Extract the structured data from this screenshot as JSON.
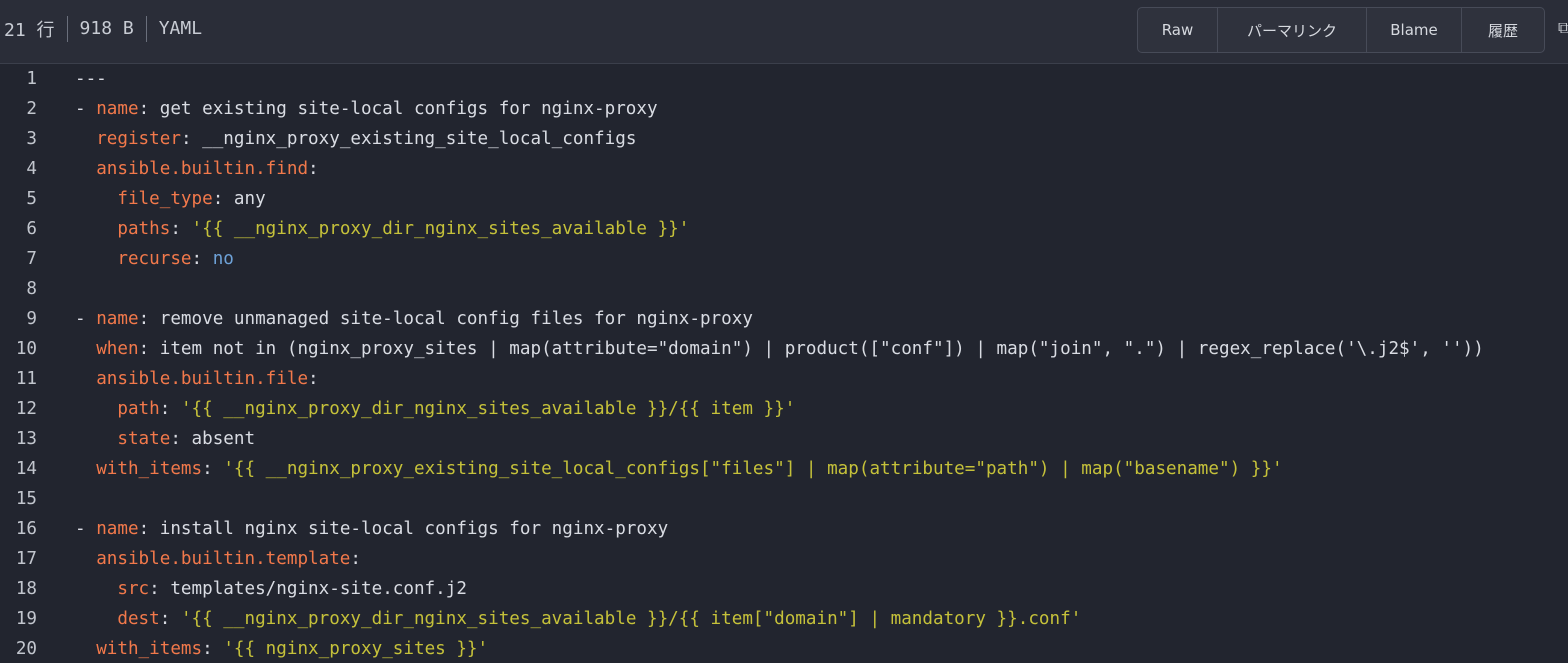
{
  "file_info": {
    "lines": "21 行",
    "size": "918 B",
    "language": "YAML"
  },
  "toolbar": {
    "raw": "Raw",
    "permalink": "パーマリンク",
    "blame": "Blame",
    "history": "履歴"
  },
  "colors": {
    "background": "#22252f",
    "key": "#f2794b",
    "string": "#c5c13a",
    "boolean": "#6ea2d8",
    "text": "#d9dce3"
  },
  "code": [
    {
      "n": "1",
      "t": [
        [
          "p",
          "---"
        ]
      ]
    },
    {
      "n": "2",
      "t": [
        [
          "p",
          "- "
        ],
        [
          "k",
          "name"
        ],
        [
          "p",
          ": get existing site-local configs for nginx-proxy"
        ]
      ]
    },
    {
      "n": "3",
      "t": [
        [
          "p",
          "  "
        ],
        [
          "k",
          "register"
        ],
        [
          "p",
          ": __nginx_proxy_existing_site_local_configs"
        ]
      ]
    },
    {
      "n": "4",
      "t": [
        [
          "p",
          "  "
        ],
        [
          "k",
          "ansible.builtin.find"
        ],
        [
          "p",
          ":"
        ]
      ]
    },
    {
      "n": "5",
      "t": [
        [
          "p",
          "    "
        ],
        [
          "k",
          "file_type"
        ],
        [
          "p",
          ": any"
        ]
      ]
    },
    {
      "n": "6",
      "t": [
        [
          "p",
          "    "
        ],
        [
          "k",
          "paths"
        ],
        [
          "p",
          ": "
        ],
        [
          "s",
          "'{{ __nginx_proxy_dir_nginx_sites_available }}'"
        ]
      ]
    },
    {
      "n": "7",
      "t": [
        [
          "p",
          "    "
        ],
        [
          "k",
          "recurse"
        ],
        [
          "p",
          ": "
        ],
        [
          "b",
          "no"
        ]
      ]
    },
    {
      "n": "8",
      "t": [
        [
          "p",
          ""
        ]
      ]
    },
    {
      "n": "9",
      "t": [
        [
          "p",
          "- "
        ],
        [
          "k",
          "name"
        ],
        [
          "p",
          ": remove unmanaged site-local config files for nginx-proxy"
        ]
      ]
    },
    {
      "n": "10",
      "t": [
        [
          "p",
          "  "
        ],
        [
          "k",
          "when"
        ],
        [
          "p",
          ": item not in (nginx_proxy_sites | map(attribute=\"domain\") | product([\"conf\"]) | map(\"join\", \".\") | regex_replace('\\.j2$', ''))"
        ]
      ]
    },
    {
      "n": "11",
      "t": [
        [
          "p",
          "  "
        ],
        [
          "k",
          "ansible.builtin.file"
        ],
        [
          "p",
          ":"
        ]
      ]
    },
    {
      "n": "12",
      "t": [
        [
          "p",
          "    "
        ],
        [
          "k",
          "path"
        ],
        [
          "p",
          ": "
        ],
        [
          "s",
          "'{{ __nginx_proxy_dir_nginx_sites_available }}/{{ item }}'"
        ]
      ]
    },
    {
      "n": "13",
      "t": [
        [
          "p",
          "    "
        ],
        [
          "k",
          "state"
        ],
        [
          "p",
          ": absent"
        ]
      ]
    },
    {
      "n": "14",
      "t": [
        [
          "p",
          "  "
        ],
        [
          "k",
          "with_items"
        ],
        [
          "p",
          ": "
        ],
        [
          "s",
          "'{{ __nginx_proxy_existing_site_local_configs[\"files\"] | map(attribute=\"path\") | map(\"basename\") }}'"
        ]
      ]
    },
    {
      "n": "15",
      "t": [
        [
          "p",
          ""
        ]
      ]
    },
    {
      "n": "16",
      "t": [
        [
          "p",
          "- "
        ],
        [
          "k",
          "name"
        ],
        [
          "p",
          ": install nginx site-local configs for nginx-proxy"
        ]
      ]
    },
    {
      "n": "17",
      "t": [
        [
          "p",
          "  "
        ],
        [
          "k",
          "ansible.builtin.template"
        ],
        [
          "p",
          ":"
        ]
      ]
    },
    {
      "n": "18",
      "t": [
        [
          "p",
          "    "
        ],
        [
          "k",
          "src"
        ],
        [
          "p",
          ": templates/nginx-site.conf.j2"
        ]
      ]
    },
    {
      "n": "19",
      "t": [
        [
          "p",
          "    "
        ],
        [
          "k",
          "dest"
        ],
        [
          "p",
          ": "
        ],
        [
          "s",
          "'{{ __nginx_proxy_dir_nginx_sites_available }}/{{ item[\"domain\"] | mandatory }}.conf'"
        ]
      ]
    },
    {
      "n": "20",
      "t": [
        [
          "p",
          "  "
        ],
        [
          "k",
          "with_items"
        ],
        [
          "p",
          ": "
        ],
        [
          "s",
          "'{{ nginx_proxy_sites }}'"
        ]
      ]
    }
  ]
}
